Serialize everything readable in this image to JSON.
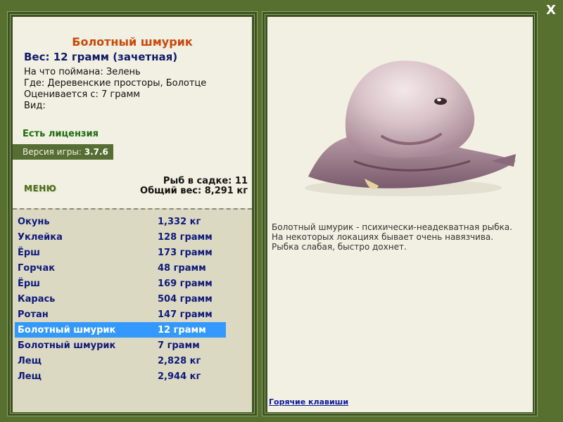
{
  "window": {
    "close_label": "X"
  },
  "fish": {
    "title": "Болотный шмурик",
    "weight_line": "Вес: 12 грамм (зачетная)",
    "details": [
      "На что поймана: Зелень",
      "Где: Деревенские просторы, Болотце",
      "Оценивается с: 7 грамм",
      "Вид:"
    ],
    "license": "Есть лицензия",
    "image_name": "blobfish-image"
  },
  "version": {
    "label": "Версия игры: ",
    "value": "3.7.6"
  },
  "menu": {
    "label": "МЕНЮ"
  },
  "stats": {
    "fish_in_cage": "Рыб в садке: 11",
    "total_weight": "Общий вес: 8,291 кг"
  },
  "catches": [
    {
      "name": "Окунь",
      "weight": "1,332 кг"
    },
    {
      "name": "Уклейка",
      "weight": "128 грамм"
    },
    {
      "name": "Ёрш",
      "weight": "173 грамм"
    },
    {
      "name": "Горчак",
      "weight": "48 грамм"
    },
    {
      "name": "Ёрш",
      "weight": "169 грамм"
    },
    {
      "name": "Карась",
      "weight": "504 грамм"
    },
    {
      "name": "Ротан",
      "weight": "147 грамм"
    },
    {
      "name": "Болотный шмурик",
      "weight": "12 грамм",
      "selected": true
    },
    {
      "name": "Болотный шмурик",
      "weight": "7 грамм"
    },
    {
      "name": "Лещ",
      "weight": "2,828 кг"
    },
    {
      "name": "Лещ",
      "weight": "2,944 кг"
    }
  ],
  "description": [
    "Болотный шмурик - психически-неадекватная рыбка.",
    "На некоторых локациях бывает очень навязчива.",
    "Рыбка слабая, быстро дохнет."
  ],
  "hotkeys": {
    "label": "Горячие клавиши"
  },
  "colors": {
    "frame_green": "#58702f",
    "panel_bg": "#f2f0e2",
    "list_bg": "#dcd9c2",
    "title_orange": "#c8480a",
    "list_text": "#0e1a7a",
    "selected_row": "#3399ff"
  }
}
